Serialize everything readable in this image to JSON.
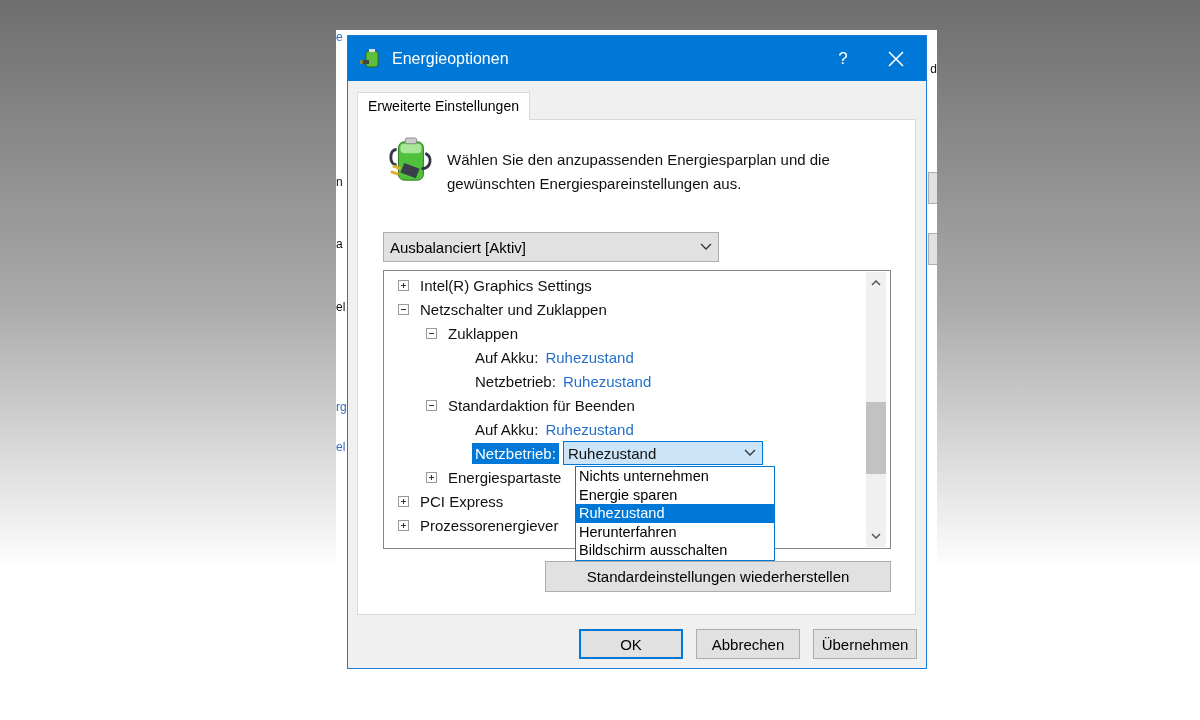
{
  "background_window": {
    "left_fragments": [
      {
        "text": "e",
        "link": true
      },
      {
        "text": "n",
        "link": false
      },
      {
        "text": "a",
        "link": false
      },
      {
        "text": "el",
        "link": false
      },
      {
        "text": "rg",
        "link": true
      },
      {
        "text": "el",
        "link": true
      }
    ],
    "right_fragments": [
      {
        "text": "d"
      }
    ]
  },
  "window": {
    "title": "Energieoptionen",
    "help": "?"
  },
  "tabs": [
    {
      "label": "Erweiterte Einstellungen",
      "selected": true
    }
  ],
  "intro": "Wählen Sie den anzupassenden Energiesparplan und die gewünschten Energiespareinstellungen aus.",
  "plan_select": {
    "value": "Ausbalanciert [Aktiv]"
  },
  "tree": [
    {
      "kind": "group",
      "label": "Intel(R) Graphics Settings",
      "expanded": false
    },
    {
      "kind": "group",
      "label": "Netzschalter und Zuklappen",
      "expanded": true,
      "children": [
        {
          "kind": "group",
          "label": "Zuklappen",
          "expanded": true,
          "children": [
            {
              "kind": "setting",
              "label": "Auf Akku:",
              "value": "Ruhezustand",
              "selected": false
            },
            {
              "kind": "setting",
              "label": "Netzbetrieb:",
              "value": "Ruhezustand",
              "selected": false
            }
          ]
        },
        {
          "kind": "group",
          "label": "Standardaktion für Beenden",
          "expanded": true,
          "children": [
            {
              "kind": "setting",
              "label": "Auf Akku:",
              "value": "Ruhezustand",
              "selected": false
            },
            {
              "kind": "setting",
              "label": "Netzbetrieb:",
              "value": "Ruhezustand",
              "selected": true
            }
          ]
        },
        {
          "kind": "group",
          "label": "Energiespartaste",
          "expanded": false
        }
      ]
    },
    {
      "kind": "group",
      "label": "PCI Express",
      "expanded": false
    },
    {
      "kind": "group",
      "label": "Prozessorenergiever",
      "expanded": false
    }
  ],
  "dropdown_options": [
    {
      "label": "Nichts unternehmen",
      "selected": false
    },
    {
      "label": "Energie sparen",
      "selected": false
    },
    {
      "label": "Ruhezustand",
      "selected": true
    },
    {
      "label": "Herunterfahren",
      "selected": false
    },
    {
      "label": "Bildschirm ausschalten",
      "selected": false
    }
  ],
  "restore_button": "Standardeinstellungen wiederherstellen",
  "buttons": [
    {
      "label": "OK",
      "default": true
    },
    {
      "label": "Abbrechen",
      "default": false
    },
    {
      "label": "Übernehmen",
      "default": false
    }
  ]
}
